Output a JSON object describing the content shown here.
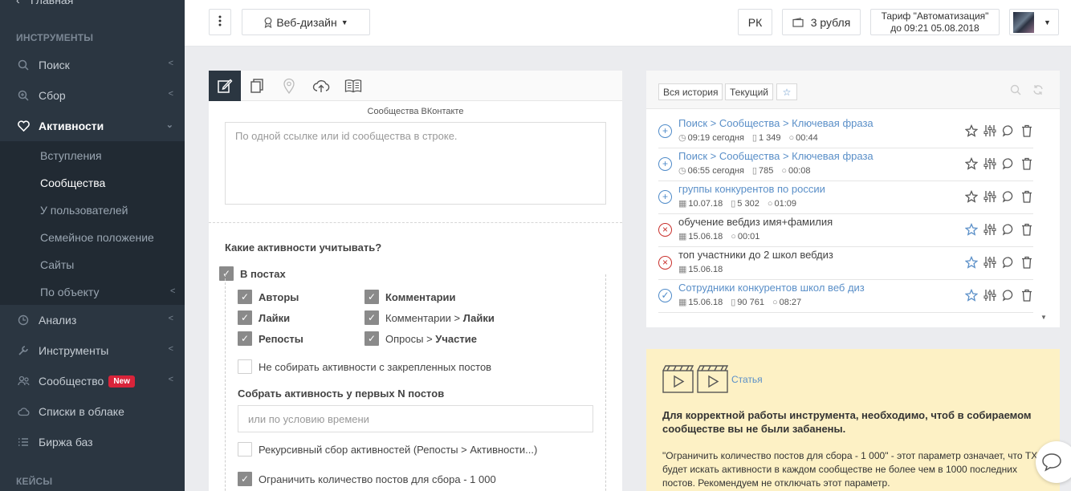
{
  "sidebar": {
    "top_item": "Главная",
    "section_tools": "ИНСТРУМЕНТЫ",
    "search": "Поиск",
    "collect": "Сбор",
    "activities": "Активности",
    "sub": [
      "Вступления",
      "Сообщества",
      "У пользователей",
      "Семейное положение",
      "Сайты",
      "По объекту"
    ],
    "analysis": "Анализ",
    "instruments": "Инструменты",
    "community": "Сообщество",
    "new_badge": "New",
    "cloud_lists": "Списки в облаке",
    "db_exchange": "Биржа баз",
    "section_cases": "КЕЙСЫ"
  },
  "topbar": {
    "project": "Веб-дизайн",
    "pk": "РК",
    "balance": "3 рубля",
    "tariff_line1": "Тариф \"Автоматизация\"",
    "tariff_line2": "до 09:21 05.08.2018"
  },
  "form": {
    "communities_caption": "Сообщества ВКонтакте",
    "communities_placeholder": "По одной ссылке или id сообщества в строке.",
    "question": "Какие активности учитывать?",
    "in_posts": "В постах",
    "authors": "Авторы",
    "comments": "Комментарии",
    "likes": "Лайки",
    "comments_prefix": "Комментарии > ",
    "comments_likes": "Лайки",
    "reposts": "Репосты",
    "polls_prefix": "Опросы > ",
    "polls_participation": "Участие",
    "skip_pinned": "Не собирать активности с закрепленных постов",
    "first_n_label": "Собрать активность у первых N постов",
    "first_n_placeholder": "или по условию времени",
    "recursive": "Рекурсивный сбор активностей (Репосты > Активности...)",
    "limit": "Ограничить количество постов для сбора - 1 000"
  },
  "history": {
    "tab_all": "Вся история",
    "tab_current": "Текущий",
    "rows": [
      {
        "title": "Поиск > Сообщества > Ключевая фраза",
        "time": "09:19 сегодня",
        "count": "1 349",
        "dur": "00:44",
        "status": "plus",
        "link": true,
        "fav": false
      },
      {
        "title": "Поиск > Сообщества > Ключевая фраза",
        "time": "06:55 сегодня",
        "count": "785",
        "dur": "00:08",
        "status": "plus",
        "link": true,
        "fav": false
      },
      {
        "title": "группы конкурентов по россии",
        "time": "10.07.18",
        "count": "5 302",
        "dur": "01:09",
        "status": "plus",
        "link": true,
        "fav": false
      },
      {
        "title": "обучение вебдиз имя+фамилия",
        "time": "15.06.18",
        "count": "",
        "dur": "00:01",
        "status": "error",
        "link": false,
        "fav": true
      },
      {
        "title": "топ участники до 2 школ вебдиз",
        "time": "15.06.18",
        "count": "",
        "dur": "",
        "status": "error",
        "link": false,
        "fav": true
      },
      {
        "title": "Сотрудники конкурентов школ веб диз",
        "time": "15.06.18",
        "count": "90 761",
        "dur": "08:27",
        "status": "check",
        "link": true,
        "fav": true
      }
    ]
  },
  "note": {
    "article_link": "Статья",
    "bold_text": "Для корректной работы инструмента, необходимо, чтоб в собираемом сообществе вы не были забанены.",
    "text": "\"Ограничить количество постов для сбора - 1 000\" - этот параметр означает, что ТХ будет искать активности в каждом сообществе не более чем в 1000 последних постов. Рекомендуем не отключать этот параметр."
  },
  "colors": {
    "sidebar_bg": "#2b3641",
    "accent_link": "#5a8fc8",
    "note_bg": "#fdf1c5",
    "badge_red": "#d9243a"
  }
}
